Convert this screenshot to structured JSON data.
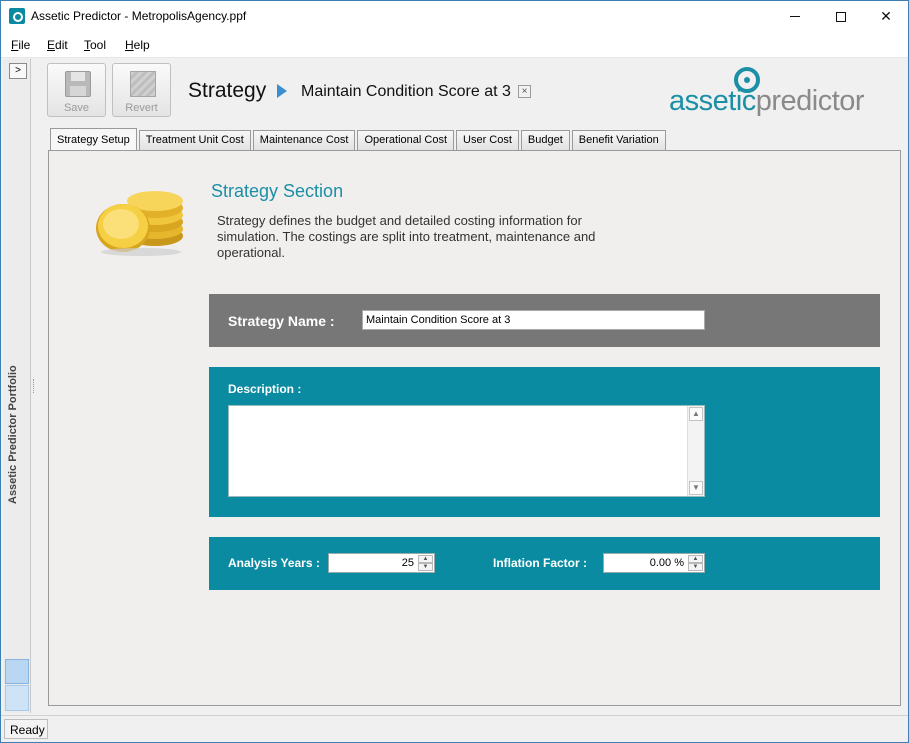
{
  "window": {
    "title": "Assetic Predictor - MetropolisAgency.ppf",
    "min_glyph": "–",
    "max_glyph": "□",
    "close_glyph": "✕"
  },
  "menu": [
    {
      "accel": "F",
      "rest": "ile"
    },
    {
      "accel": "E",
      "rest": "dit"
    },
    {
      "accel": "T",
      "rest": "ool"
    },
    {
      "accel": "H",
      "rest": "elp"
    }
  ],
  "side_panel": {
    "title": "Assetic Predictor Portfolio",
    "expand_glyph": ">"
  },
  "toolbar": {
    "save_label": "Save",
    "revert_label": "Revert"
  },
  "header": {
    "title": "Strategy",
    "strategy_name": "Maintain Condition Score at 3",
    "close_glyph": "×"
  },
  "logo": {
    "part1": "assetic",
    "part2": "predictor"
  },
  "tabs": [
    {
      "label": "Strategy Setup",
      "active": true
    },
    {
      "label": "Treatment Unit Cost",
      "active": false
    },
    {
      "label": "Maintenance Cost",
      "active": false
    },
    {
      "label": "Operational Cost",
      "active": false
    },
    {
      "label": "User Cost",
      "active": false
    },
    {
      "label": "Budget",
      "active": false
    },
    {
      "label": "Benefit Variation",
      "active": false
    }
  ],
  "section": {
    "title": "Strategy Section",
    "description": "Strategy defines the budget and detailed costing information for simulation. The costings are split into treatment, maintenance and operational."
  },
  "form": {
    "name_label": "Strategy Name :",
    "name_value": "Maintain Condition Score at 3",
    "description_label": "Description :",
    "description_value": "",
    "years_label": "Analysis Years :",
    "years_value": "25",
    "inflation_label": "Inflation Factor :",
    "inflation_value": "0.00 %"
  },
  "status": {
    "text": "Ready"
  },
  "colors": {
    "accent_teal": "#0b8ba2",
    "band_gray": "#777777",
    "logo_gray": "#8a8a8a"
  }
}
